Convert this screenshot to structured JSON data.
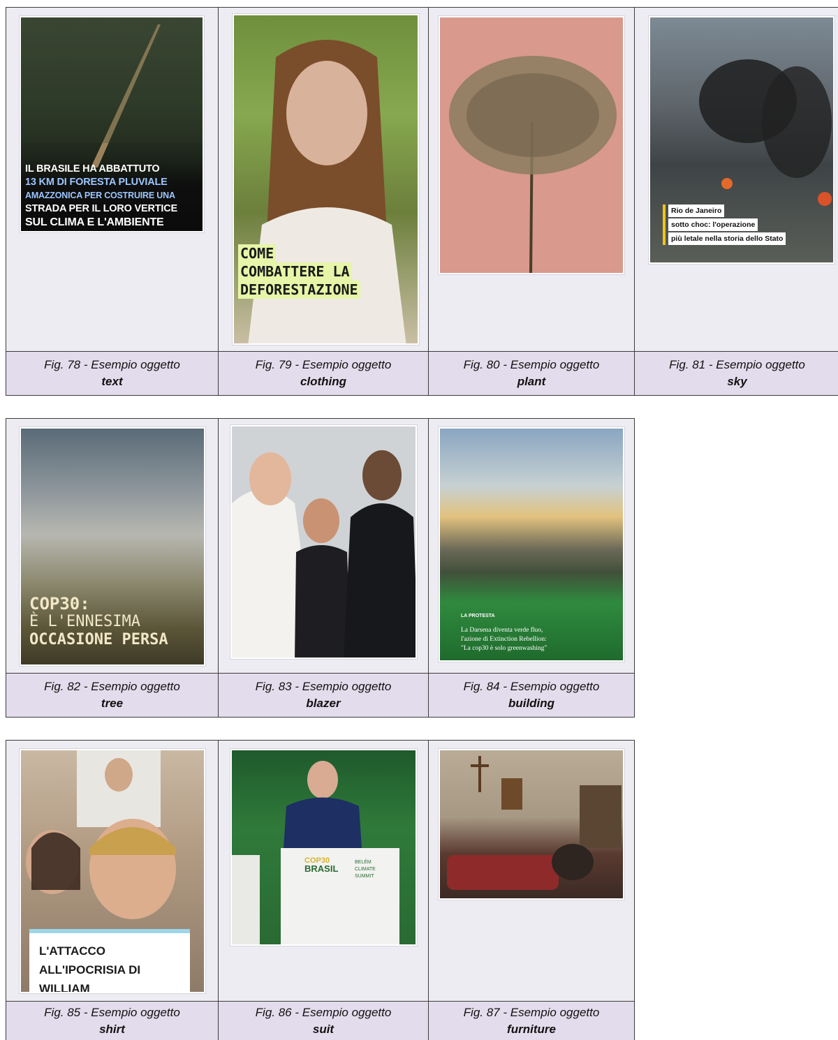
{
  "caption_prefix": "Fig.",
  "caption_middle": "- Esempio oggetto",
  "figures": [
    {
      "num": "78",
      "caption": "Fig. 78 - Esempio oggetto",
      "object": "text",
      "overlay_lines": [
        "IL BRASILE HA ABBATTUTO",
        "13 KM DI FORESTA PLUVIALE",
        "AMAZZONICA PER COSTRUIRE UNA",
        "STRADA PER IL LORO VERTICE",
        "SUL CLIMA E L'AMBIENTE"
      ]
    },
    {
      "num": "79",
      "caption": "Fig. 79 - Esempio oggetto",
      "object": "clothing",
      "overlay_lines": [
        "COME",
        "COMBATTERE LA",
        "DEFORESTAZIONE"
      ]
    },
    {
      "num": "80",
      "caption": "Fig. 80 - Esempio oggetto",
      "object": "plant"
    },
    {
      "num": "81",
      "caption": "Fig. 81 - Esempio oggetto",
      "object": "sky",
      "overlay_lines": [
        "Rio de Janeiro",
        "sotto choc: l'operazione",
        "più letale nella storia dello Stato"
      ]
    },
    {
      "num": "82",
      "caption": "Fig. 82 - Esempio oggetto",
      "object": "tree",
      "overlay_lines": [
        "COP30:",
        "È L'ENNESIMA",
        "OCCASIONE PERSA"
      ]
    },
    {
      "num": "83",
      "caption": "Fig. 83 - Esempio oggetto",
      "object": "blazer"
    },
    {
      "num": "84",
      "caption": "Fig. 84 - Esempio oggetto",
      "object": "building",
      "overlay_lines": [
        "LA PROTESTA",
        "La Darsena diventa verde fluo,",
        "l'azione di Extinction Rebellion:",
        "\"La cop30 è solo greenwashing\""
      ]
    },
    {
      "num": "85",
      "caption": "Fig. 85 - Esempio oggetto",
      "object": "shirt",
      "overlay_lines": [
        "L'ATTACCO",
        "ALL'IPOCRISIA DI",
        "WILLIAM"
      ]
    },
    {
      "num": "86",
      "caption": "Fig. 86 - Esempio oggetto",
      "object": "suit",
      "overlay_lines": [
        "COP30",
        "BRASIL",
        "BELÉM",
        "CLIMATE",
        "SUMMIT"
      ]
    },
    {
      "num": "87",
      "caption": "Fig. 87 - Esempio oggetto",
      "object": "furniture"
    }
  ],
  "colors": {
    "cell_bg": "#eeecf3",
    "caption_bg": "#e3dcec",
    "border": "#3b3b3b"
  }
}
